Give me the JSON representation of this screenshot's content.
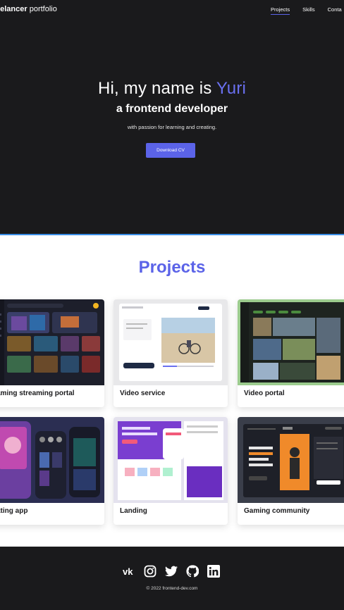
{
  "header": {
    "logo_bold": "eelancer",
    "logo_light": " portfolio",
    "nav": [
      "Projects",
      "Skills",
      "Conta"
    ]
  },
  "hero": {
    "greeting": "Hi, my name is ",
    "name": "Yuri",
    "role": "a frontend developer",
    "tagline": "with passion for learning and creating.",
    "cta": "Download CV"
  },
  "projects": {
    "title": "Projects",
    "items": [
      {
        "label": "aming streaming portal"
      },
      {
        "label": "Video service"
      },
      {
        "label": "Video portal"
      },
      {
        "label": "ating app"
      },
      {
        "label": "Landing"
      },
      {
        "label": "Gaming community"
      }
    ]
  },
  "footer": {
    "socials": [
      "vk-icon",
      "instagram-icon",
      "twitter-icon",
      "github-icon",
      "linkedin-icon"
    ],
    "copyright": "© 2022 frontend-dev.com"
  },
  "colors": {
    "accent": "#5b63e8",
    "dark": "#1a1a1c",
    "hero_border": "#3a8de6"
  }
}
